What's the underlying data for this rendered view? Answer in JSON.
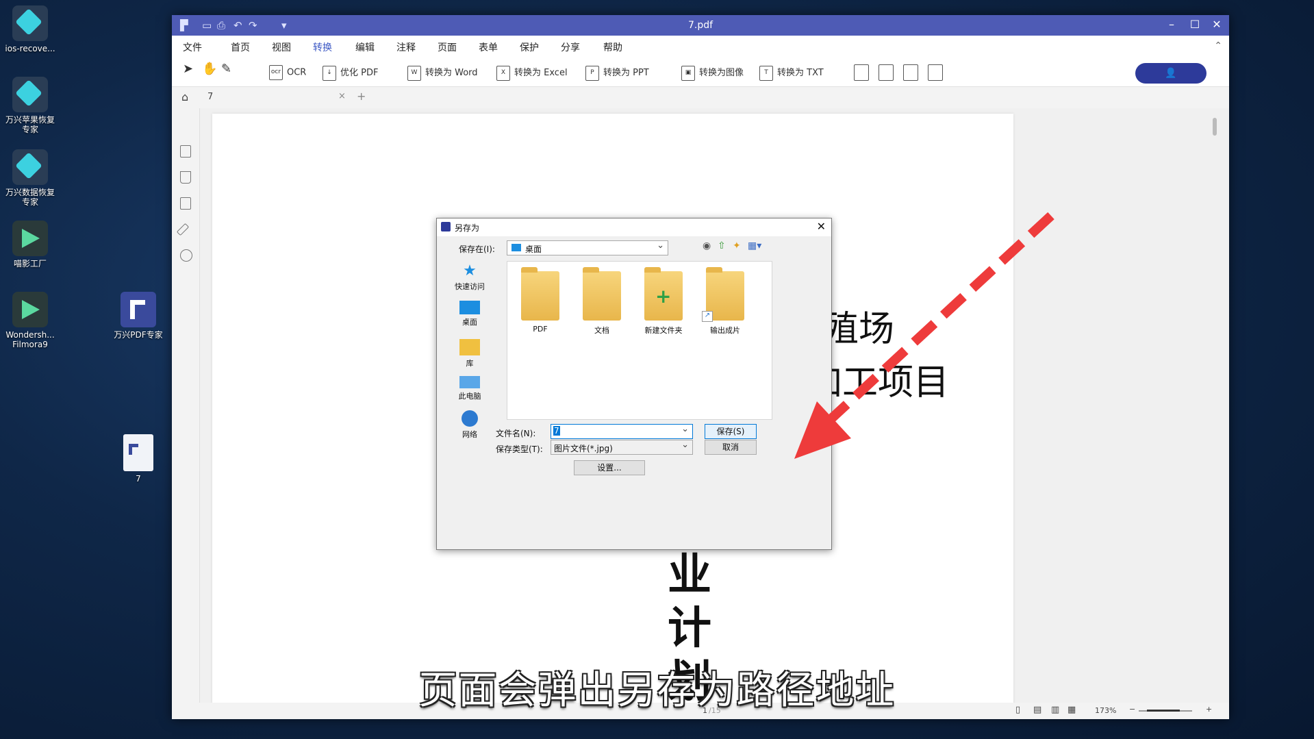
{
  "desktop": {
    "icons": [
      {
        "label": "ios-recove...",
        "label2": ""
      },
      {
        "label": "万兴苹果恢复",
        "label2": "专家"
      },
      {
        "label": "万兴数据恢复",
        "label2": "专家"
      },
      {
        "label": "喵影工厂",
        "label2": ""
      },
      {
        "label": "Wondersh...",
        "label2": "Filmora9"
      },
      {
        "label": "万兴PDF专家",
        "label2": ""
      },
      {
        "label": "7",
        "label2": ""
      }
    ]
  },
  "app": {
    "title": "7.pdf",
    "menu": [
      "文件",
      "首页",
      "视图",
      "转换",
      "编辑",
      "注释",
      "页面",
      "表单",
      "保护",
      "分享",
      "帮助"
    ],
    "active_menu": "转换",
    "toolbar": {
      "ocr": "OCR",
      "optimize": "优化 PDF",
      "to_word": "转换为  Word",
      "to_excel": "转换为  Excel",
      "to_ppt": "转换为  PPT",
      "to_image": "转换为图像",
      "to_txt": "转换为 TXT",
      "user_icon": "user-icon"
    },
    "tab": {
      "label": "7",
      "close": "×",
      "add": "+"
    },
    "document": {
      "line1": "殖场",
      "line2": "加工项目",
      "line3": "业",
      "line4": "计",
      "line5": "划"
    },
    "status": {
      "page": "1",
      "total": "/15",
      "zoom": "173%"
    }
  },
  "dialog": {
    "title": "另存为",
    "save_in_label": "保存在(I):",
    "save_in_value": "桌面",
    "places": [
      "快速访问",
      "桌面",
      "库",
      "此电脑",
      "网络"
    ],
    "files": [
      "PDF",
      "文档",
      "新建文件夹",
      "输出成片"
    ],
    "filename_label": "文件名(N):",
    "filename_value": "7",
    "filetype_label": "保存类型(T):",
    "filetype_value": "图片文件(*.jpg)",
    "save_button": "保存(S)",
    "cancel_button": "取消",
    "settings_button": "设置..."
  },
  "subtitle": "页面会弹出另存为路径地址",
  "colors": {
    "accent": "#4e5bb5",
    "arrow": "#ee3b3b"
  }
}
